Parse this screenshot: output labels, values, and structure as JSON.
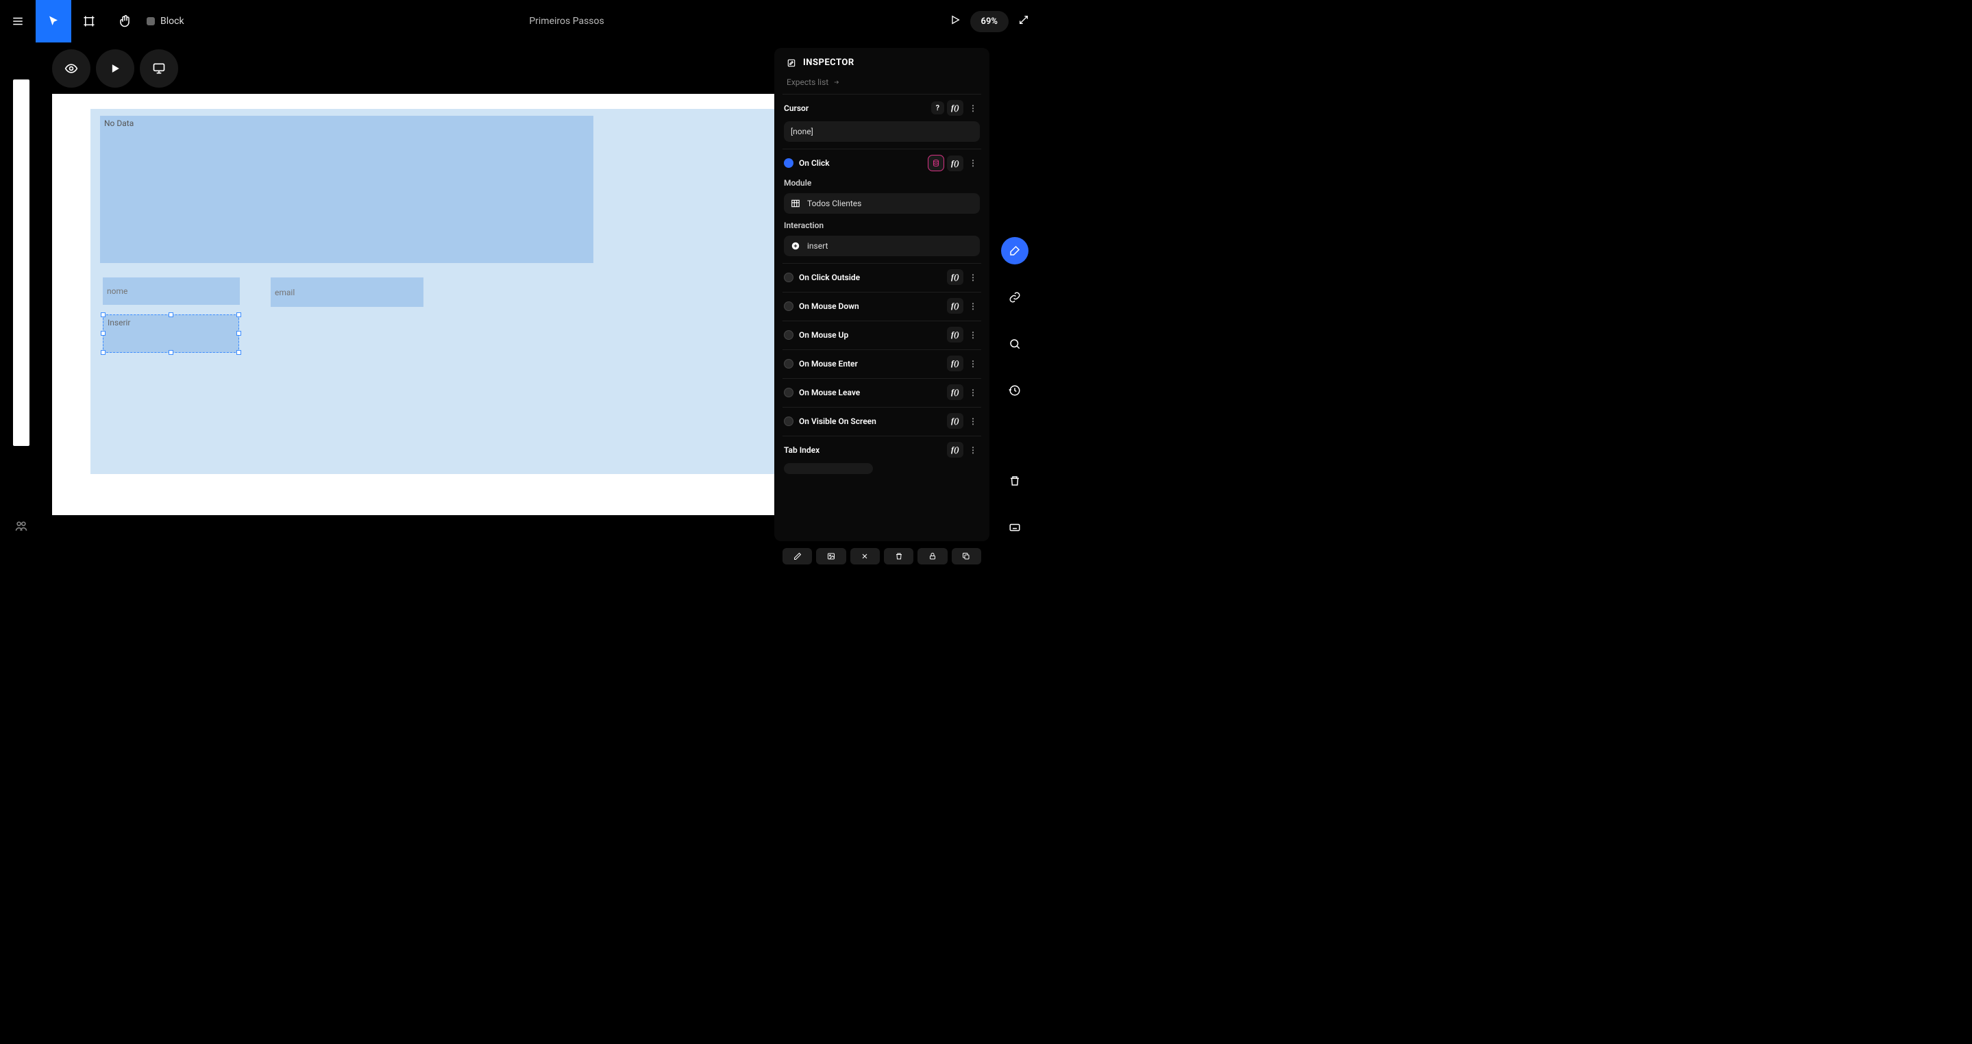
{
  "header": {
    "block_label": "Block",
    "title": "Primeiros Passos",
    "zoom": "69%"
  },
  "canvas": {
    "no_data": "No Data",
    "nome_placeholder": "nome",
    "email_placeholder": "email",
    "inserir_label": "Inserir"
  },
  "inspector": {
    "title": "INSPECTOR",
    "expects_list": "Expects list",
    "cursor": {
      "label": "Cursor",
      "value": "[none]"
    },
    "on_click": {
      "label": "On Click",
      "module_label": "Module",
      "module_value": "Todos Clientes",
      "interaction_label": "Interaction",
      "interaction_value": "insert"
    },
    "events": {
      "on_click_outside": "On Click Outside",
      "on_mouse_down": "On Mouse Down",
      "on_mouse_up": "On Mouse Up",
      "on_mouse_enter": "On Mouse Enter",
      "on_mouse_leave": "On Mouse Leave",
      "on_visible": "On Visible On Screen"
    },
    "tab_index_label": "Tab Index"
  }
}
